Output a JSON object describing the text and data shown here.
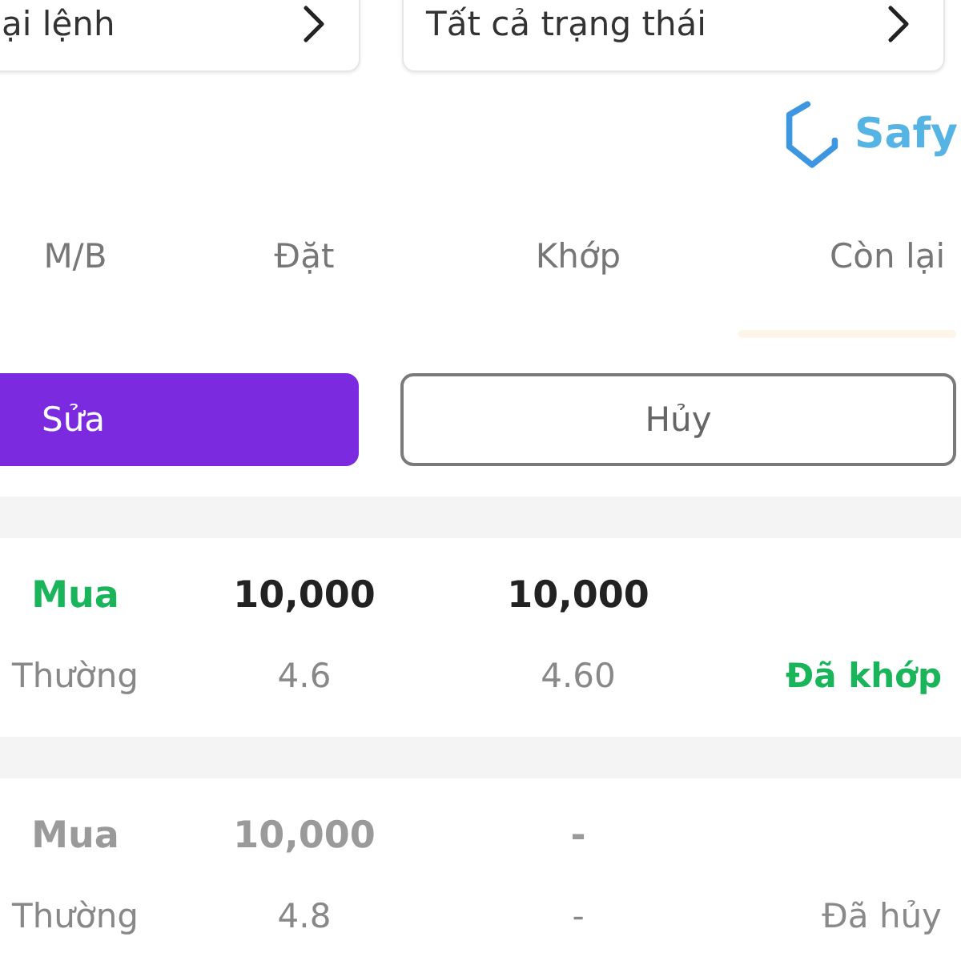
{
  "filters": [
    {
      "label": "ại lệnh"
    },
    {
      "label": "Tất cả trạng thái"
    }
  ],
  "brand": {
    "name": "Safy"
  },
  "columns": [
    "M/B",
    "Đặt",
    "Khớp",
    "Còn lại"
  ],
  "actions": [
    {
      "label": "Sửa",
      "kind": "primary"
    },
    {
      "label": "Hủy",
      "kind": "outline"
    }
  ],
  "orders": [
    {
      "kind": "matched",
      "side": "Mua",
      "ordered_qty": "10,000",
      "matched_qty": "10,000",
      "order_type": "Thường",
      "order_price": "4.6",
      "matched_price": "4.60",
      "status": "Đã khớp"
    },
    {
      "kind": "cancelled",
      "side": "Mua",
      "ordered_qty": "10,000",
      "matched_qty": "-",
      "order_type": "Thường",
      "order_price": "4.8",
      "matched_price": "-",
      "status": "Đã hủy"
    }
  ]
}
